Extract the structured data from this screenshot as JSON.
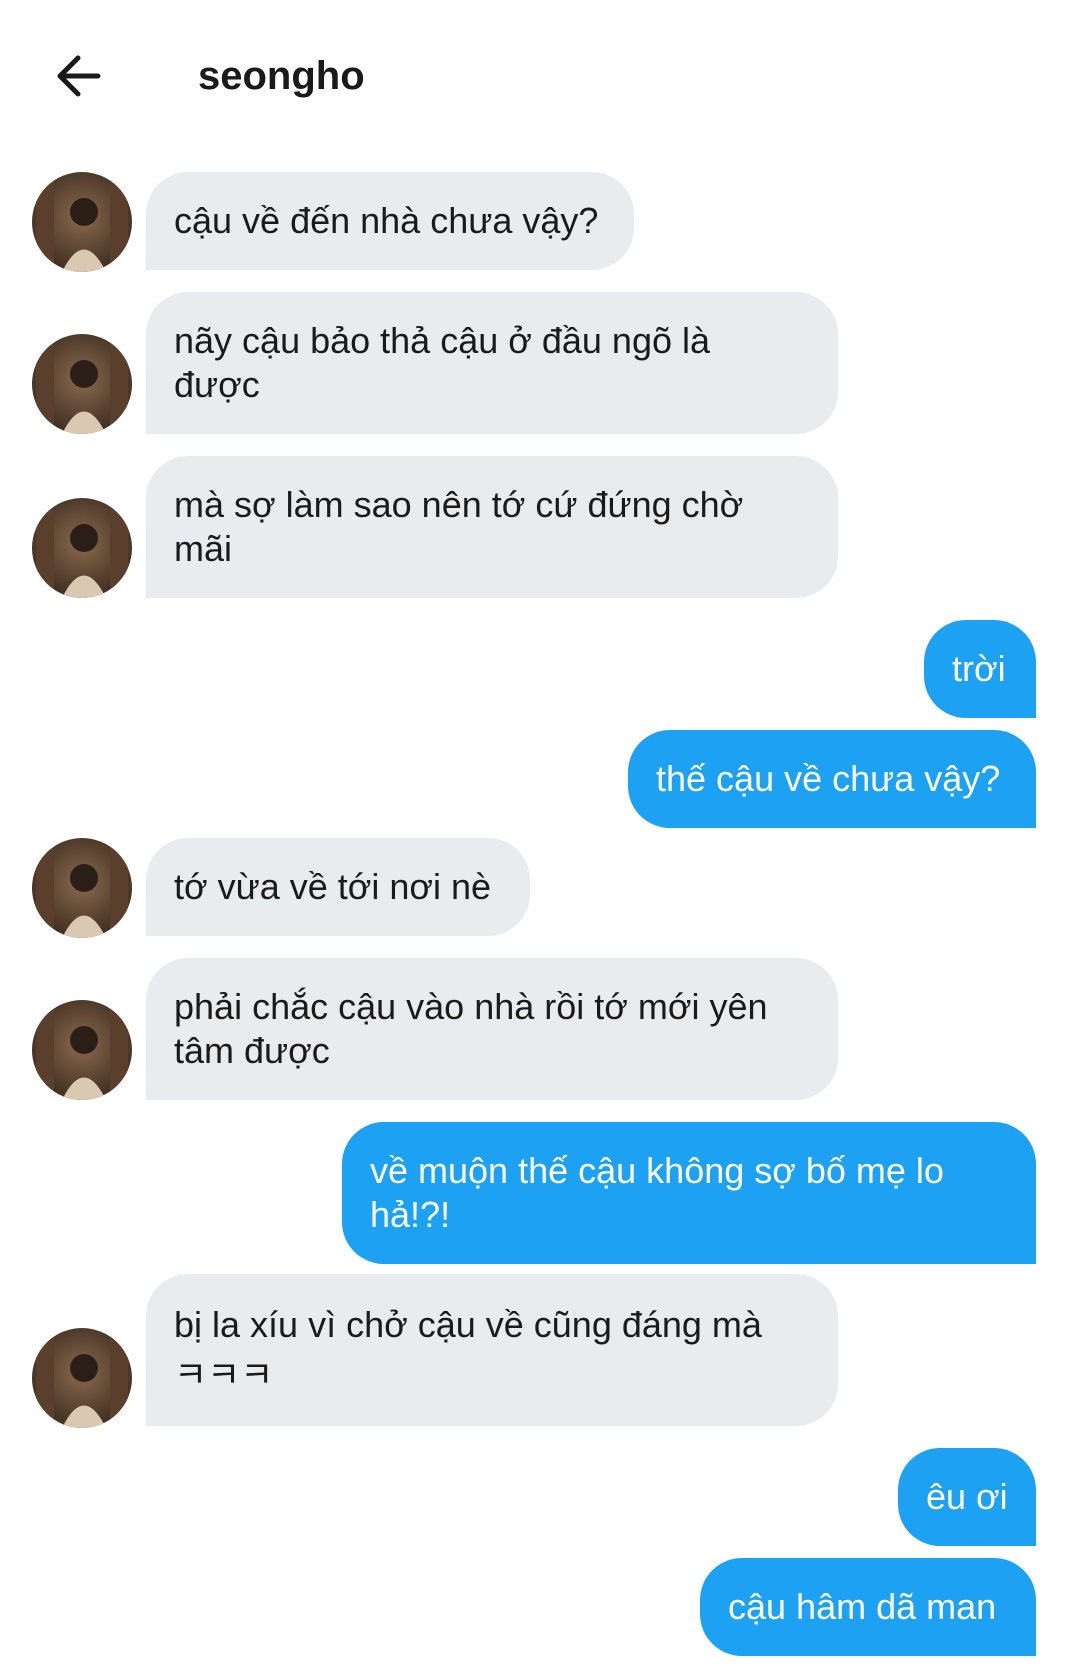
{
  "header": {
    "back_icon": "arrow-left-icon",
    "title": "seongho"
  },
  "messages": [
    {
      "direction": "in",
      "text": "cậu về đến nhà chưa vậy?"
    },
    {
      "direction": "in",
      "text": "nãy cậu bảo thả cậu ở đầu ngõ là\nđược"
    },
    {
      "direction": "in",
      "text": "mà sợ làm sao nên tớ cứ đứng chờ\nmãi"
    },
    {
      "direction": "out",
      "text": "trời"
    },
    {
      "direction": "out",
      "text": "thế cậu về chưa vậy?"
    },
    {
      "direction": "in",
      "text": "tớ vừa về tới nơi nè"
    },
    {
      "direction": "in",
      "text": "phải chắc cậu vào nhà rồi tớ mới yên\ntâm được"
    },
    {
      "direction": "out",
      "text": "về muộn thế cậu không sợ bố mẹ lo\nhả!?!"
    },
    {
      "direction": "in",
      "text": "bị la xíu vì chở cậu về cũng đáng mà\nㅋㅋㅋ"
    },
    {
      "direction": "out",
      "text": "êu ơi"
    },
    {
      "direction": "out",
      "text": "cậu hâm dã man"
    }
  ],
  "colors": {
    "incoming_bubble": "#e9ecef",
    "outgoing_bubble": "#1da1f2",
    "incoming_text": "#1a1a1a",
    "outgoing_text": "#ffffff"
  }
}
